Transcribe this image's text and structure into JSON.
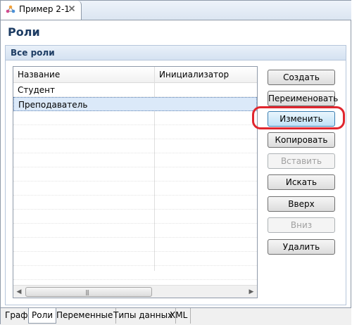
{
  "editor_tab": {
    "title": "Пример 2-1",
    "icon": "graph-icon",
    "close_icon": "close-icon"
  },
  "page_title": "Роли",
  "section": {
    "title": "Все роли"
  },
  "table": {
    "columns": [
      "Название",
      "Инициализатор"
    ],
    "rows": [
      {
        "name": "Студент",
        "initializer": ""
      },
      {
        "name": "Преподаватель",
        "initializer": "",
        "selected": true
      }
    ]
  },
  "buttons": {
    "create": "Создать",
    "rename": "Переименовать",
    "edit": "Изменить",
    "copy": "Копировать",
    "paste": "Вставить",
    "search": "Искать",
    "up": "Вверх",
    "down": "Вниз",
    "delete": "Удалить"
  },
  "bottom_tabs": [
    "Граф",
    "Роли",
    "Переменные",
    "Типы данных",
    "XML"
  ],
  "active_bottom_tab": "Роли",
  "highlight_color": "#e0262e"
}
